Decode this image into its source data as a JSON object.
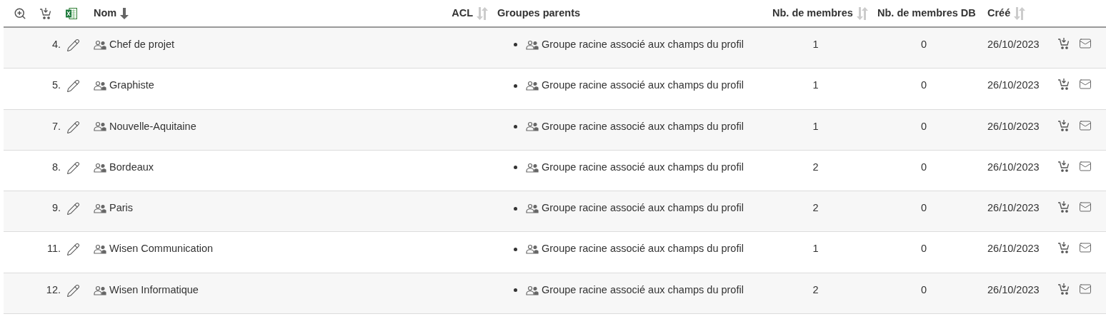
{
  "columns": [
    {
      "label": "Nom",
      "sortable": true,
      "sorted": true
    },
    {
      "label": "ACL",
      "sortable": true,
      "sorted": false
    },
    {
      "label": "Groupes parents",
      "sortable": false
    },
    {
      "label": "Nb. de membres",
      "sortable": true,
      "sorted": false
    },
    {
      "label": "Nb. de membres DB",
      "sortable": false
    },
    {
      "label": "Créé",
      "sortable": true,
      "sorted": false
    }
  ],
  "rows": [
    {
      "index": "4.",
      "name": "Chef de projet",
      "parents": [
        "Groupe racine associé aux champs du profil"
      ],
      "members": "1",
      "members_db": "0",
      "created": "26/10/2023"
    },
    {
      "index": "5.",
      "name": "Graphiste",
      "parents": [
        "Groupe racine associé aux champs du profil"
      ],
      "members": "1",
      "members_db": "0",
      "created": "26/10/2023"
    },
    {
      "index": "7.",
      "name": "Nouvelle-Aquitaine",
      "parents": [
        "Groupe racine associé aux champs du profil"
      ],
      "members": "1",
      "members_db": "0",
      "created": "26/10/2023"
    },
    {
      "index": "8.",
      "name": "Bordeaux",
      "parents": [
        "Groupe racine associé aux champs du profil"
      ],
      "members": "2",
      "members_db": "0",
      "created": "26/10/2023"
    },
    {
      "index": "9.",
      "name": "Paris",
      "parents": [
        "Groupe racine associé aux champs du profil"
      ],
      "members": "2",
      "members_db": "0",
      "created": "26/10/2023"
    },
    {
      "index": "11.",
      "name": "Wisen Communication",
      "parents": [
        "Groupe racine associé aux champs du profil"
      ],
      "members": "1",
      "members_db": "0",
      "created": "26/10/2023"
    },
    {
      "index": "12.",
      "name": "Wisen Informatique",
      "parents": [
        "Groupe racine associé aux champs du profil"
      ],
      "members": "2",
      "members_db": "0",
      "created": "26/10/2023"
    }
  ]
}
